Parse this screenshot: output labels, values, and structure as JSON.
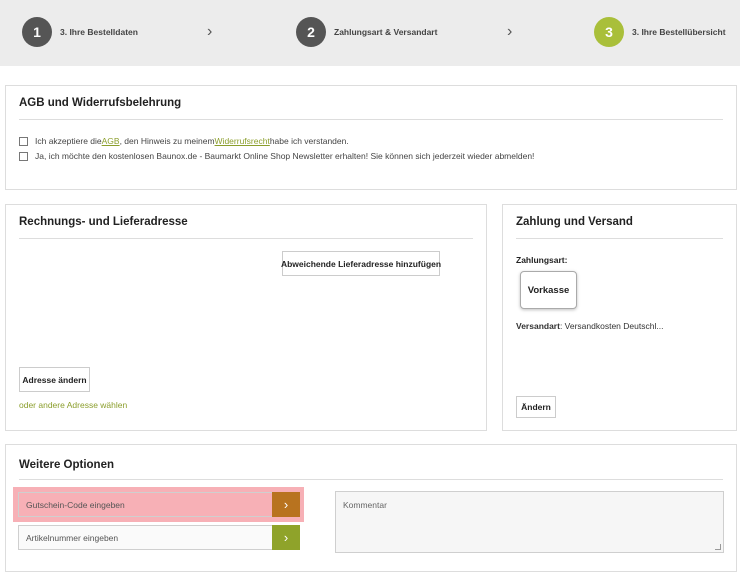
{
  "steps": [
    {
      "number": "1",
      "label": "3. Ihre Bestelldaten"
    },
    {
      "number": "2",
      "label": "Zahlungsart & Versandart"
    },
    {
      "number": "3",
      "label": "3. Ihre Bestellübersicht"
    }
  ],
  "step_separator": "›",
  "agb": {
    "title": "AGB und Widerrufsbelehrung",
    "line1_prefix": "Ich akzeptiere die ",
    "line1_agb_link": "AGB",
    "line1_middle": " , den Hinweis zu meinem ",
    "line1_widerruf_link": "Widerrufsrecht",
    "line1_suffix": " habe ich verstanden.",
    "line2": "Ja, ich möchte den kostenlosen Baunox.de - Baumarkt Online Shop Newsletter erhalten! Sie können sich jederzeit wieder abmelden!"
  },
  "address": {
    "title": "Rechnungs- und Lieferadresse",
    "alt_delivery_button": "Abweichende Lieferadresse hinzufügen",
    "change_button": "Adresse ändern",
    "other_address_link": "oder andere Adresse wählen"
  },
  "payment": {
    "title": "Zahlung und Versand",
    "payment_label": "Zahlungsart:",
    "payment_method": "Vorkasse",
    "shipping_label": "Versandart",
    "shipping_value": ": Versandkosten Deutschl...",
    "change_button": "Ändern"
  },
  "options": {
    "title": "Weitere Optionen",
    "voucher_placeholder": "Gutschein-Code eingeben",
    "article_placeholder": "Artikelnummer eingeben",
    "comment_placeholder": "Kommentar",
    "go_symbol": "›"
  },
  "colors": {
    "accent_green": "#a9bf3a",
    "voucher_button": "#b8731f",
    "article_button": "#8fa32a",
    "highlight": "#f7b0b6"
  }
}
